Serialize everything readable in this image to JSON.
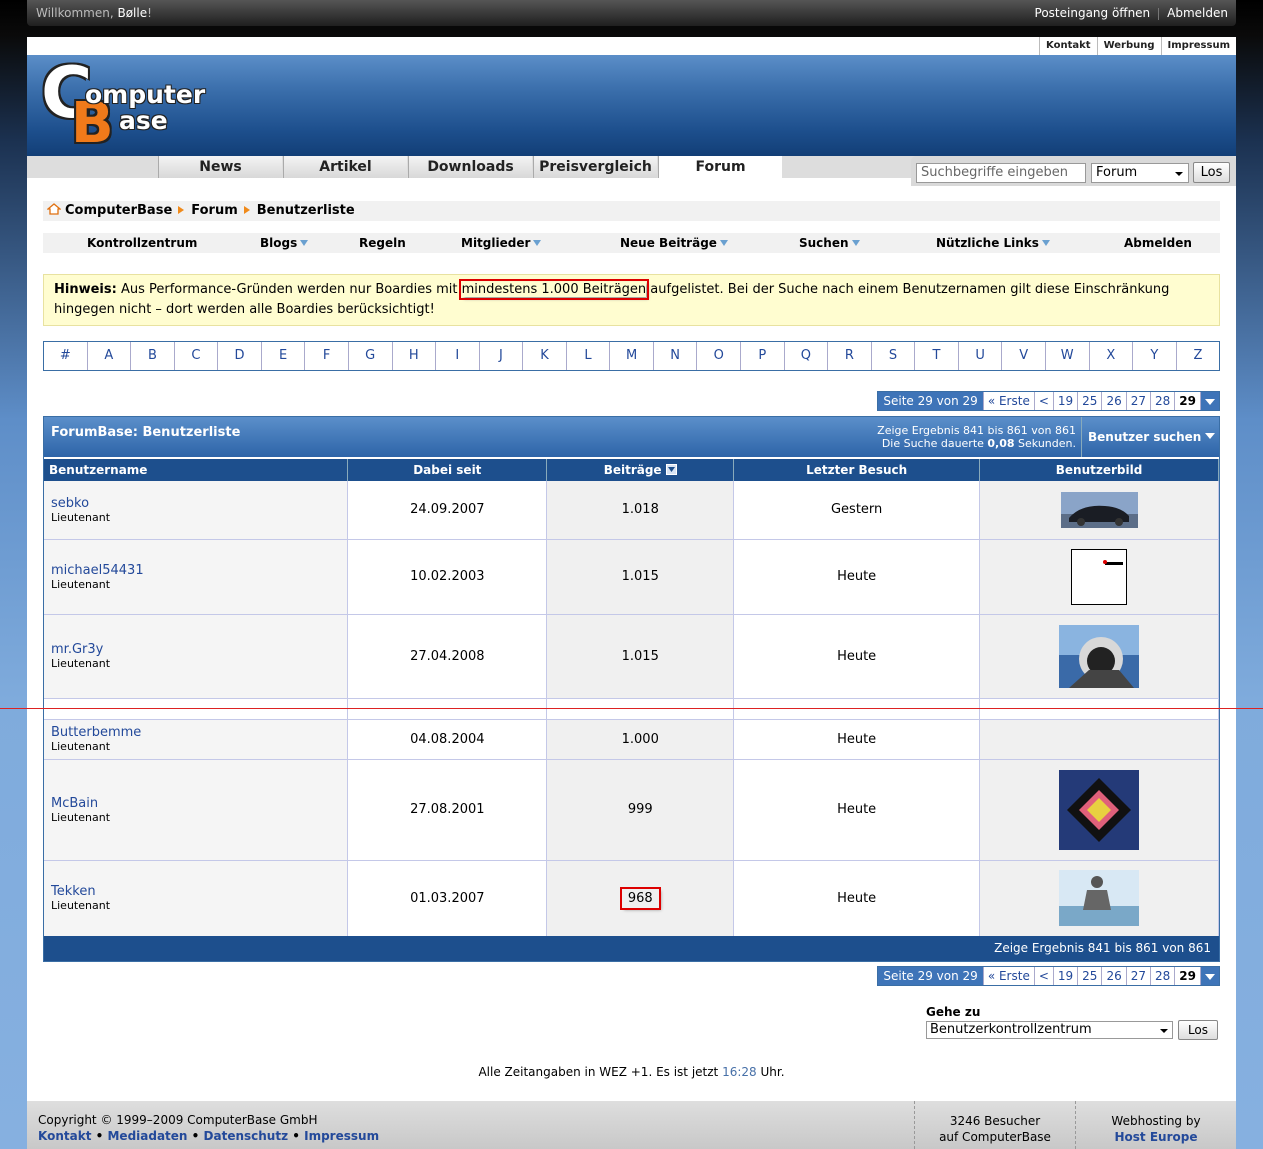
{
  "topbar": {
    "welcome_prefix": "Willkommen, ",
    "user": "Bølle",
    "welcome_suffix": "!",
    "inbox": "Posteingang öffnen",
    "logout": "Abmelden"
  },
  "toplinks": [
    "Kontakt",
    "Werbung",
    "Impressum"
  ],
  "logo": {
    "line1": "omputer",
    "line2": "ase",
    "c": "C",
    "b": "B"
  },
  "nav": [
    "News",
    "Artikel",
    "Downloads",
    "Preisvergleich",
    "Forum"
  ],
  "search": {
    "placeholder": "Suchbegriffe eingeben",
    "scope": "Forum",
    "button": "Los"
  },
  "breadcrumb": [
    "ComputerBase",
    "Forum",
    "Benutzerliste"
  ],
  "subnav": [
    "Kontrollzentrum",
    "Blogs",
    "Regeln",
    "Mitglieder",
    "Neue Beiträge",
    "Suchen",
    "Nützliche Links",
    "Abmelden"
  ],
  "notice": {
    "label": "Hinweis:",
    "text1": " Aus Performance-Gründen werden nur Boardies mit ",
    "highlight": "mindestens 1.000 Beiträgen",
    "text2": " aufgelistet. Bei der Suche nach einem Benutzernamen gilt diese Einschränkung hingegen nicht – dort werden alle Boardies berücksichtigt!"
  },
  "letters": [
    "#",
    "A",
    "B",
    "C",
    "D",
    "E",
    "F",
    "G",
    "H",
    "I",
    "J",
    "K",
    "L",
    "M",
    "N",
    "O",
    "P",
    "Q",
    "R",
    "S",
    "T",
    "U",
    "V",
    "W",
    "X",
    "Y",
    "Z"
  ],
  "pager": {
    "label": "Seite 29 von 29",
    "first": "« Erste",
    "prev": "<",
    "pages": [
      "19",
      "25",
      "26",
      "27",
      "28"
    ],
    "current": "29"
  },
  "table": {
    "title": "ForumBase: Benutzerliste",
    "info1": "Zeige Ergebnis 841 bis 861 von 861",
    "info2_pre": "Die Suche dauerte ",
    "info2_val": "0,08",
    "info2_post": " Sekunden.",
    "user_search": "Benutzer suchen",
    "columns": [
      "Benutzername",
      "Dabei seit",
      "Beiträge",
      "Letzter Besuch",
      "Benutzerbild"
    ],
    "rows": [
      {
        "name": "sebko",
        "rank": "Lieutenant",
        "since": "24.09.2007",
        "posts": "1.018",
        "last": "Gestern"
      },
      {
        "name": "michael54431",
        "rank": "Lieutenant",
        "since": "10.02.2003",
        "posts": "1.015",
        "last": "Heute"
      },
      {
        "name": "mr.Gr3y",
        "rank": "Lieutenant",
        "since": "27.04.2008",
        "posts": "1.015",
        "last": "Heute"
      },
      {
        "name": "Butterbemme",
        "rank": "Lieutenant",
        "since": "04.08.2004",
        "posts": "1.000",
        "last": "Heute"
      },
      {
        "name": "McBain",
        "rank": "Lieutenant",
        "since": "27.08.2001",
        "posts": "999",
        "last": "Heute"
      },
      {
        "name": "Tekken",
        "rank": "Lieutenant",
        "since": "01.03.2007",
        "posts": "968",
        "last": "Heute"
      }
    ],
    "footer": "Zeige Ergebnis 841 bis 861 von 861"
  },
  "gehezu": {
    "label": "Gehe zu",
    "selected": "Benutzerkontrollzentrum",
    "button": "Los"
  },
  "time": {
    "pre": "Alle Zeitangaben in WEZ +1. Es ist jetzt ",
    "time": "16:28",
    "post": " Uhr."
  },
  "footer": {
    "copyright": "Copyright © 1999–2009 ComputerBase GmbH",
    "links": [
      "Kontakt",
      "Mediadaten",
      "Datenschutz",
      "Impressum"
    ],
    "visitors1": "3246 Besucher",
    "visitors2": "auf ComputerBase",
    "host1": "Webhosting by",
    "host2": "Host Europe"
  }
}
